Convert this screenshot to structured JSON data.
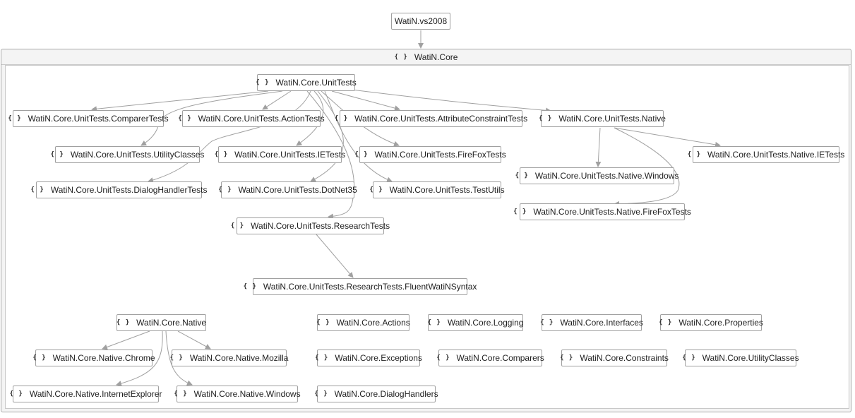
{
  "diagram": {
    "project_node": "WatiN.vs2008",
    "group_title": "WatiN.Core",
    "namespace_icon": "braces-icon",
    "nodes": {
      "unittests": "WatiN.Core.UnitTests",
      "comparertests": "WatiN.Core.UnitTests.ComparerTests",
      "actiontests": "WatiN.Core.UnitTests.ActionTests",
      "attributeconstrainttests": "WatiN.Core.UnitTests.AttributeConstraintTests",
      "unittests_native": "WatiN.Core.UnitTests.Native",
      "utilityclasses_tests": "WatiN.Core.UnitTests.UtilityClasses",
      "ietests": "WatiN.Core.UnitTests.IETests",
      "firefoxtests": "WatiN.Core.UnitTests.FireFoxTests",
      "native_ietests": "WatiN.Core.UnitTests.Native.IETests",
      "native_windows_tests": "WatiN.Core.UnitTests.Native.Windows",
      "dialoghandlertests": "WatiN.Core.UnitTests.DialogHandlerTests",
      "dotnet35": "WatiN.Core.UnitTests.DotNet35",
      "testutils": "WatiN.Core.UnitTests.TestUtils",
      "native_firefoxtests": "WatiN.Core.UnitTests.Native.FireFoxTests",
      "researchtests": "WatiN.Core.UnitTests.ResearchTests",
      "fluentwatinsyntax": "WatiN.Core.UnitTests.ResearchTests.FluentWatiNSyntax",
      "native": "WatiN.Core.Native",
      "actions": "WatiN.Core.Actions",
      "logging": "WatiN.Core.Logging",
      "interfaces": "WatiN.Core.Interfaces",
      "properties": "WatiN.Core.Properties",
      "native_chrome": "WatiN.Core.Native.Chrome",
      "native_mozilla": "WatiN.Core.Native.Mozilla",
      "exceptions": "WatiN.Core.Exceptions",
      "comparers": "WatiN.Core.Comparers",
      "constraints": "WatiN.Core.Constraints",
      "utilityclasses": "WatiN.Core.UtilityClasses",
      "native_internetexplorer": "WatiN.Core.Native.InternetExplorer",
      "native_windows": "WatiN.Core.Native.Windows",
      "dialoghandlers": "WatiN.Core.DialogHandlers"
    },
    "edges": [
      [
        "project",
        "group"
      ],
      [
        "unittests",
        "comparertests"
      ],
      [
        "unittests",
        "actiontests"
      ],
      [
        "unittests",
        "attributeconstrainttests"
      ],
      [
        "unittests",
        "unittests_native"
      ],
      [
        "unittests",
        "utilityclasses_tests"
      ],
      [
        "unittests",
        "ietests"
      ],
      [
        "unittests",
        "firefoxtests"
      ],
      [
        "unittests",
        "dialoghandlertests"
      ],
      [
        "unittests",
        "dotnet35"
      ],
      [
        "unittests",
        "testutils"
      ],
      [
        "unittests",
        "researchtests"
      ],
      [
        "unittests_native",
        "native_ietests"
      ],
      [
        "unittests_native",
        "native_windows_tests"
      ],
      [
        "unittests_native",
        "native_firefoxtests"
      ],
      [
        "researchtests",
        "fluentwatinsyntax"
      ],
      [
        "native",
        "native_chrome"
      ],
      [
        "native",
        "native_mozilla"
      ],
      [
        "native",
        "native_internetexplorer"
      ],
      [
        "native",
        "native_windows"
      ]
    ],
    "colors": {
      "edge": "#a0a0a0",
      "node_border": "#a0a0a0",
      "group_fill": "#f4f4f4"
    }
  }
}
